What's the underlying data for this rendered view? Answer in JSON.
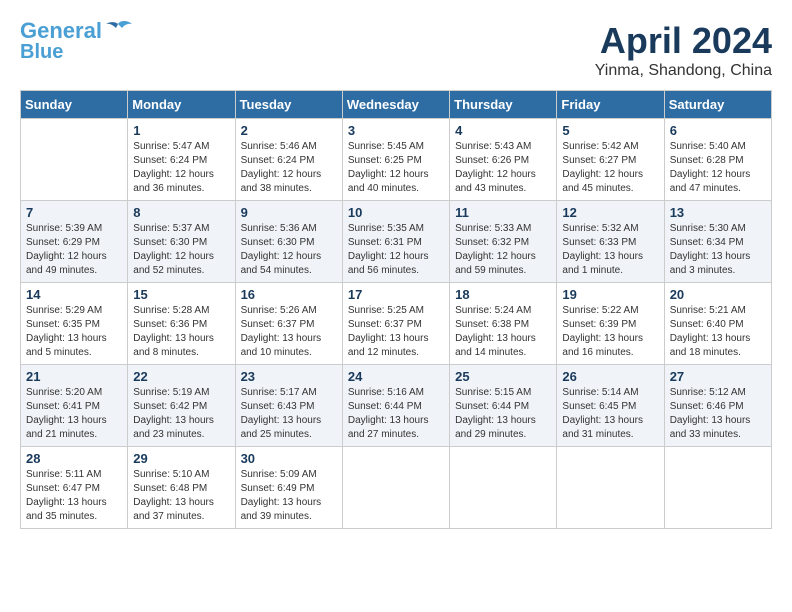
{
  "header": {
    "logo_line1": "General",
    "logo_line2": "Blue",
    "title": "April 2024",
    "subtitle": "Yinma, Shandong, China"
  },
  "days_of_week": [
    "Sunday",
    "Monday",
    "Tuesday",
    "Wednesday",
    "Thursday",
    "Friday",
    "Saturday"
  ],
  "weeks": [
    {
      "days": [
        {
          "num": "",
          "info": ""
        },
        {
          "num": "1",
          "info": "Sunrise: 5:47 AM\nSunset: 6:24 PM\nDaylight: 12 hours\nand 36 minutes."
        },
        {
          "num": "2",
          "info": "Sunrise: 5:46 AM\nSunset: 6:24 PM\nDaylight: 12 hours\nand 38 minutes."
        },
        {
          "num": "3",
          "info": "Sunrise: 5:45 AM\nSunset: 6:25 PM\nDaylight: 12 hours\nand 40 minutes."
        },
        {
          "num": "4",
          "info": "Sunrise: 5:43 AM\nSunset: 6:26 PM\nDaylight: 12 hours\nand 43 minutes."
        },
        {
          "num": "5",
          "info": "Sunrise: 5:42 AM\nSunset: 6:27 PM\nDaylight: 12 hours\nand 45 minutes."
        },
        {
          "num": "6",
          "info": "Sunrise: 5:40 AM\nSunset: 6:28 PM\nDaylight: 12 hours\nand 47 minutes."
        }
      ]
    },
    {
      "days": [
        {
          "num": "7",
          "info": "Sunrise: 5:39 AM\nSunset: 6:29 PM\nDaylight: 12 hours\nand 49 minutes."
        },
        {
          "num": "8",
          "info": "Sunrise: 5:37 AM\nSunset: 6:30 PM\nDaylight: 12 hours\nand 52 minutes."
        },
        {
          "num": "9",
          "info": "Sunrise: 5:36 AM\nSunset: 6:30 PM\nDaylight: 12 hours\nand 54 minutes."
        },
        {
          "num": "10",
          "info": "Sunrise: 5:35 AM\nSunset: 6:31 PM\nDaylight: 12 hours\nand 56 minutes."
        },
        {
          "num": "11",
          "info": "Sunrise: 5:33 AM\nSunset: 6:32 PM\nDaylight: 12 hours\nand 59 minutes."
        },
        {
          "num": "12",
          "info": "Sunrise: 5:32 AM\nSunset: 6:33 PM\nDaylight: 13 hours\nand 1 minute."
        },
        {
          "num": "13",
          "info": "Sunrise: 5:30 AM\nSunset: 6:34 PM\nDaylight: 13 hours\nand 3 minutes."
        }
      ]
    },
    {
      "days": [
        {
          "num": "14",
          "info": "Sunrise: 5:29 AM\nSunset: 6:35 PM\nDaylight: 13 hours\nand 5 minutes."
        },
        {
          "num": "15",
          "info": "Sunrise: 5:28 AM\nSunset: 6:36 PM\nDaylight: 13 hours\nand 8 minutes."
        },
        {
          "num": "16",
          "info": "Sunrise: 5:26 AM\nSunset: 6:37 PM\nDaylight: 13 hours\nand 10 minutes."
        },
        {
          "num": "17",
          "info": "Sunrise: 5:25 AM\nSunset: 6:37 PM\nDaylight: 13 hours\nand 12 minutes."
        },
        {
          "num": "18",
          "info": "Sunrise: 5:24 AM\nSunset: 6:38 PM\nDaylight: 13 hours\nand 14 minutes."
        },
        {
          "num": "19",
          "info": "Sunrise: 5:22 AM\nSunset: 6:39 PM\nDaylight: 13 hours\nand 16 minutes."
        },
        {
          "num": "20",
          "info": "Sunrise: 5:21 AM\nSunset: 6:40 PM\nDaylight: 13 hours\nand 18 minutes."
        }
      ]
    },
    {
      "days": [
        {
          "num": "21",
          "info": "Sunrise: 5:20 AM\nSunset: 6:41 PM\nDaylight: 13 hours\nand 21 minutes."
        },
        {
          "num": "22",
          "info": "Sunrise: 5:19 AM\nSunset: 6:42 PM\nDaylight: 13 hours\nand 23 minutes."
        },
        {
          "num": "23",
          "info": "Sunrise: 5:17 AM\nSunset: 6:43 PM\nDaylight: 13 hours\nand 25 minutes."
        },
        {
          "num": "24",
          "info": "Sunrise: 5:16 AM\nSunset: 6:44 PM\nDaylight: 13 hours\nand 27 minutes."
        },
        {
          "num": "25",
          "info": "Sunrise: 5:15 AM\nSunset: 6:44 PM\nDaylight: 13 hours\nand 29 minutes."
        },
        {
          "num": "26",
          "info": "Sunrise: 5:14 AM\nSunset: 6:45 PM\nDaylight: 13 hours\nand 31 minutes."
        },
        {
          "num": "27",
          "info": "Sunrise: 5:12 AM\nSunset: 6:46 PM\nDaylight: 13 hours\nand 33 minutes."
        }
      ]
    },
    {
      "days": [
        {
          "num": "28",
          "info": "Sunrise: 5:11 AM\nSunset: 6:47 PM\nDaylight: 13 hours\nand 35 minutes."
        },
        {
          "num": "29",
          "info": "Sunrise: 5:10 AM\nSunset: 6:48 PM\nDaylight: 13 hours\nand 37 minutes."
        },
        {
          "num": "30",
          "info": "Sunrise: 5:09 AM\nSunset: 6:49 PM\nDaylight: 13 hours\nand 39 minutes."
        },
        {
          "num": "",
          "info": ""
        },
        {
          "num": "",
          "info": ""
        },
        {
          "num": "",
          "info": ""
        },
        {
          "num": "",
          "info": ""
        }
      ]
    }
  ]
}
